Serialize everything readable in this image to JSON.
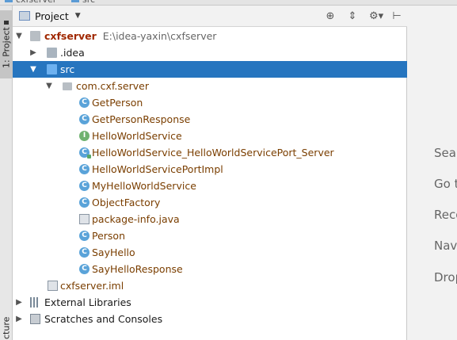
{
  "tabs": [
    "cxfserver",
    "src"
  ],
  "toolstrip": {
    "project_tab": "1: Project",
    "structure_tab": "cture"
  },
  "header": {
    "title": "Project"
  },
  "tree": {
    "root_name": "cxfserver",
    "root_path": "E:\\idea-yaxin\\cxfserver",
    "idea": ".idea",
    "src": "src",
    "package": "com.cxf.server",
    "classes": [
      "GetPerson",
      "GetPersonResponse",
      "HelloWorldService",
      "HelloWorldService_HelloWorldServicePort_Server",
      "HelloWorldServicePortImpl",
      "MyHelloWorldService",
      "ObjectFactory",
      "package-info.java",
      "Person",
      "SayHello",
      "SayHelloResponse"
    ],
    "iml": "cxfserver.iml",
    "external_libraries": "External Libraries",
    "scratches": "Scratches and Consoles"
  },
  "welcome": [
    "Sear",
    "Go t",
    "Reco",
    "Nav",
    "Drop"
  ],
  "colors": {
    "selection": "#2675bf",
    "class_icon": "#5aa3d9",
    "interface_icon": "#6fb26f",
    "file_text": "#7a3e00"
  }
}
